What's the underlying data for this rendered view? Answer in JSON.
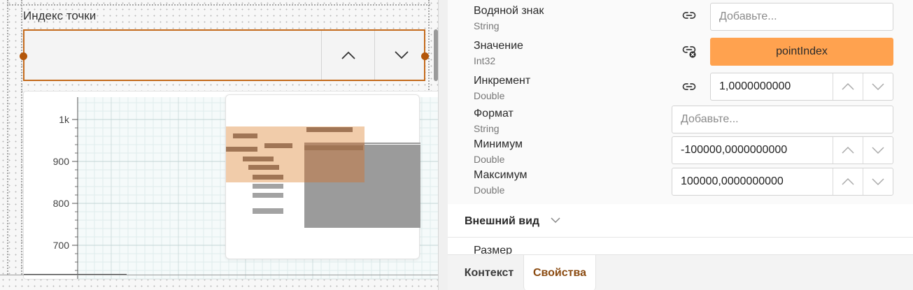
{
  "canvas": {
    "widget_title": "Индекс точки",
    "spinner": {
      "value": "",
      "up_icon": "chevron-up-icon",
      "down_icon": "chevron-down-icon",
      "accent_color": "#c46a1b"
    },
    "chart": {
      "y_ticks": [
        "1k",
        "900",
        "800",
        "700"
      ]
    }
  },
  "properties": {
    "items": [
      {
        "name": "Водяной знак",
        "type": "String",
        "placeholder": "Добавьте...",
        "binding_icon": "link-icon"
      },
      {
        "name": "Значение",
        "type": "Int32",
        "binding": "pointIndex",
        "binding_icon": "link-remove-icon",
        "binding_color": "#ffa24f"
      },
      {
        "name": "Инкремент",
        "type": "Double",
        "value": "1,0000000000",
        "binding_icon": "link-icon"
      },
      {
        "name": "Формат",
        "type": "String",
        "placeholder": "Добавьте..."
      },
      {
        "name": "Минимум",
        "type": "Double",
        "value": "-100000,0000000000"
      },
      {
        "name": "Максимум",
        "type": "Double",
        "value": "100000,0000000000"
      }
    ],
    "section_appearance": "Внешний вид",
    "size_label": "Размер"
  },
  "tabs": {
    "context": "Контекст",
    "properties": "Свойства",
    "active": "properties"
  }
}
